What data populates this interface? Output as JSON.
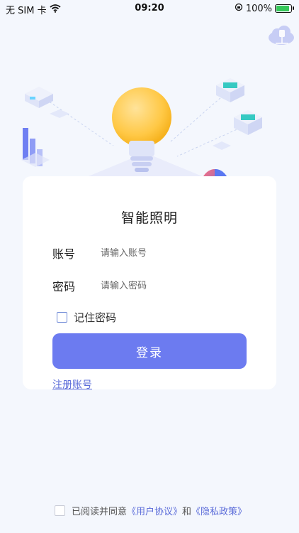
{
  "status_bar": {
    "carrier": "无 SIM 卡",
    "time": "09:20",
    "battery_percent": "100%",
    "battery_level": 1.0
  },
  "app": {
    "title": "智能照明"
  },
  "form": {
    "account_label": "账号",
    "account_placeholder": "请输入账号",
    "account_value": "",
    "password_label": "密码",
    "password_placeholder": "请输入密码",
    "password_value": "",
    "remember_label": "记住密码",
    "remember_checked": false,
    "login_label": "登录",
    "register_label": "注册账号"
  },
  "agreement": {
    "prefix": "已阅读并同意",
    "user_agreement": "《用户协议》",
    "and": "和",
    "privacy_policy": "《隐私政策》",
    "checked": false
  },
  "colors": {
    "accent": "#6c7bf0",
    "link": "#5b6cd9",
    "background": "#f4f7fd",
    "card": "#ffffff",
    "battery": "#35c759"
  },
  "icons": {
    "wifi": "wifi-icon",
    "lock_rotation": "rotation-lock-icon",
    "battery": "battery-charging-icon",
    "cloud": "cloud-network-icon"
  }
}
